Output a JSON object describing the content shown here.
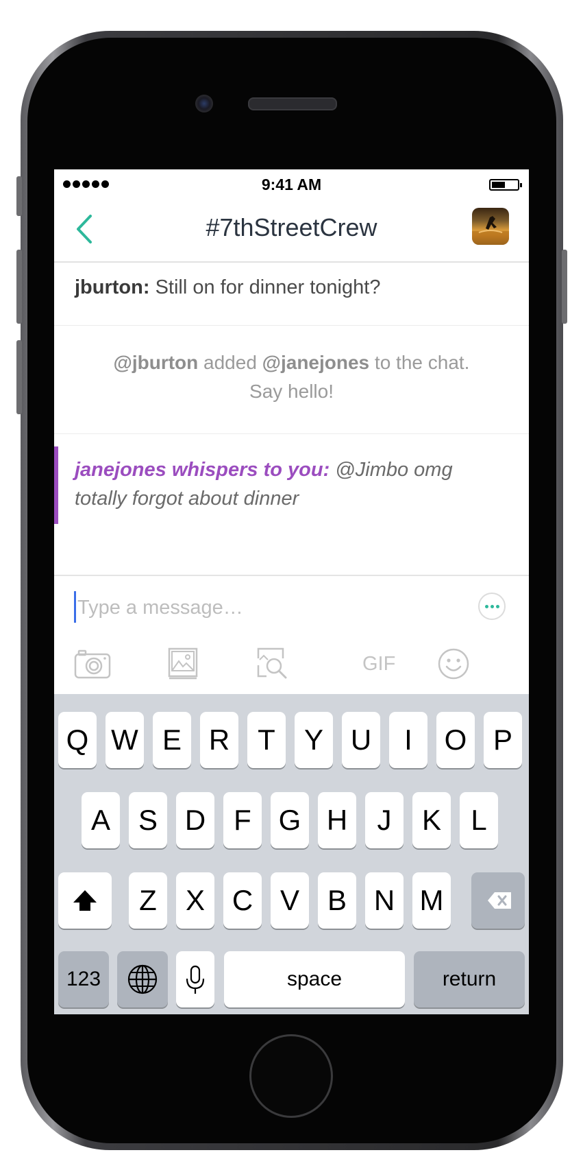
{
  "status_bar": {
    "time": "9:41 AM"
  },
  "nav": {
    "title": "#7thStreetCrew"
  },
  "messages": [
    {
      "type": "message",
      "author": "jburton:",
      "text": " Still on for dinner tonight?"
    },
    {
      "type": "system",
      "line1": {
        "actor": "@jburton",
        "verb": " added ",
        "target": "@janejones",
        "rest": " to the chat."
      },
      "line2": "Say hello!"
    },
    {
      "type": "whisper",
      "author": "janejones whispers to you:",
      "text_line1": " @Jimbo omg",
      "text_line2": "totally forgot about dinner"
    }
  ],
  "composer": {
    "placeholder": "Type a message…",
    "toolbar": {
      "gif_label": "GIF",
      "icons": [
        "camera-icon",
        "photo-library-icon",
        "image-search-icon",
        "gif-button",
        "emoji-icon"
      ]
    }
  },
  "keyboard": {
    "row1": [
      "Q",
      "W",
      "E",
      "R",
      "T",
      "Y",
      "U",
      "I",
      "O",
      "P"
    ],
    "row2": [
      "A",
      "S",
      "D",
      "F",
      "G",
      "H",
      "J",
      "K",
      "L"
    ],
    "row3": [
      "Z",
      "X",
      "C",
      "V",
      "B",
      "N",
      "M"
    ],
    "numbers_label": "123",
    "space_label": "space",
    "return_label": "return"
  },
  "colors": {
    "accent_teal": "#2db89b",
    "whisper_purple": "#9b4dbf",
    "cursor_blue": "#3b6ee8",
    "keyboard_bg": "#d1d5db"
  }
}
